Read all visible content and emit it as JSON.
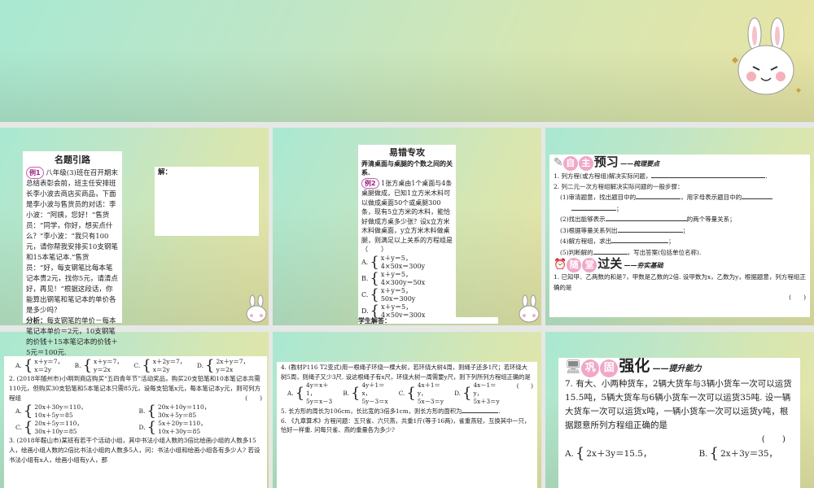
{
  "slide1": {
    "title": "名题引路",
    "badge": "例1",
    "text": "八年级(3)班在召开期末总结表彰会前，班主任安排班长李小波去商店买商品，下面是李小波与售货员的对话：李小波：“阿姨，您好！”售货员：“同学，你好，想买点什么？”李小波：“我只有100元，请你帮我安排买10支钢笔和15本笔记本.”售货员：“好，每支钢笔比每本笔记本贵2元，找你5元，请清点好，再见！”根据这段话，你能算出钢笔和笔记本的单价各是多少吗？",
    "analysis_label": "分析：",
    "analysis": "每支钢笔的单价－每本笔记本单价＝2元，10支钢笔的价钱＋15本笔记本的价钱＋5元＝100元.",
    "answer_label": "解："
  },
  "slide2": {
    "title": "易错专攻",
    "hint": "弄清桌面与桌腿的个数之间的关系.",
    "badge": "例2",
    "text": "1张方桌由1个桌面与4条桌腿做成，已知1立方米木料可以做成桌面50个或桌腿300条，现有5立方米的木料，能恰好做成方桌多少张？设x立方米木料做桌面，y立方米木料做桌腿，则满足以上关系的方程组是（　　）",
    "options": [
      {
        "label": "A.",
        "l1": "x＋y＝5，",
        "l2": "4×50x＝300y"
      },
      {
        "label": "B.",
        "l1": "x＋y＝5，",
        "l2": "4×300y＝50x"
      },
      {
        "label": "C.",
        "l1": "x＋y＝5，",
        "l2": "50x＝300y"
      },
      {
        "label": "D.",
        "l1": "x＋y＝5，",
        "l2": "4×50y＝300x"
      }
    ],
    "student": "学生解答："
  },
  "slide3": {
    "h1a": "自",
    "h1b": "主",
    "h1c": "预习",
    "h1sub": "——梳理要点",
    "items": [
      "1. 列方程(或方程组)解决实际问题，",
      "2. 列二元一次方程组解决实际问题的一般步骤：",
      "(1)审清题意，找出题目中的",
      "，用字母表示题目中的",
      "；",
      "(2)找出能够表示",
      "的两个等量关系；",
      "(3)根据等量关系列出",
      "；",
      "(4)解方程组，求出",
      "；",
      "(5)判断解的",
      "，写出答案(包括单位名称)."
    ],
    "h2a": "随",
    "h2b": "堂",
    "h2c": "过关",
    "h2sub": "——夯实基础",
    "q1": "1. 已知甲、乙两数的和是7，甲数是乙数的2倍. 设甲数为x，乙数为y，根据题意，列方程组正确的是",
    "paren": "(　　)"
  },
  "slide4": {
    "q1opts": [
      {
        "label": "A.",
        "l1": "x＋y＝7，",
        "l2": "x＝2y"
      },
      {
        "label": "B.",
        "l1": "x＋y＝7，",
        "l2": "y＝2x"
      },
      {
        "label": "C.",
        "l1": "x＋2y＝7，",
        "l2": "x＝2y"
      },
      {
        "label": "D.",
        "l1": "2x＋y＝7，",
        "l2": "y＝2x"
      }
    ],
    "q2": "2. (2018年随州市)小明到商店购买“五四青年节”活动奖品，购买20支铅笔和10本笔记本共需110元，但购买30支铅笔和5本笔记本只需85元，设每支铅笔x元，每本笔记本y元，则可列方程组",
    "paren": "(　　)",
    "q2opts": [
      {
        "label": "A.",
        "l1": "20x＋30y＝110，",
        "l2": "10x＋5y＝85"
      },
      {
        "label": "B.",
        "l1": "20x＋10y＝110，",
        "l2": "30x＋5y＝85"
      },
      {
        "label": "C.",
        "l1": "20x＋5y＝110，",
        "l2": "30x＋10y＝85"
      },
      {
        "label": "D.",
        "l1": "5x＋20y＝110，",
        "l2": "10x＋30y＝85"
      }
    ],
    "q3": "3. (2018年鞍山市)某班有若干个活动小组，其中书法小组人数的3倍比绘画小组的人数多15人，绘画小组人数的2倍比书法小组的人数多5人，问：书法小组和绘画小组各有多少人? 若设书法小组有x人，绘画小组有y人，那"
  },
  "slide5": {
    "q4": "4. (教材P116 T2变式)用一根绳子环绕一棵大树，若环绕大树4周，则绳子还多1尺；若环绕大树5周，则绳子又少3尺. 设这根绳子有x尺，环绕大树一周需要y尺，则下列所列方程组正确的是",
    "paren": "(　　)",
    "opts": [
      {
        "label": "A.",
        "l1": "4y＝x＋1，",
        "l2": "5y＝x－3"
      },
      {
        "label": "B.",
        "l1": "4y＋1＝x，",
        "l2": "5y－3＝x"
      },
      {
        "label": "C.",
        "l1": "4x＋1＝y，",
        "l2": "5x－3＝y"
      },
      {
        "label": "D.",
        "l1": "4x－1＝y，",
        "l2": "5x＋3＝y"
      }
    ],
    "q5": "5. 长方形的周长为106cm，长比宽的3倍多1cm，则长方形的面积为",
    "q6": "6. 《九章算术》方程问题：五只雀、六只燕，共重1斤(等于16两)，雀重燕轻，互换其中一只，恰好一样重. 问每只雀、燕的重量各为多少?"
  },
  "slide6": {
    "ha": "巩",
    "hb": "固",
    "hc": "强化",
    "hsub": "——提升能力",
    "q7": "7. 有大、小两种货车，2辆大货车与3辆小货车一次可以运货15.5吨，5辆大货车与6辆小货车一次可以运货35吨. 设一辆大货车一次可以运货x吨，一辆小货车一次可以运货y吨，根据题意所列方程组正确的是",
    "paren": "(　　)",
    "opts": [
      {
        "label": "A.",
        "l1": "2x＋3y＝15.5，"
      },
      {
        "label": "B.",
        "l1": "2x＋3y＝35，"
      }
    ]
  }
}
